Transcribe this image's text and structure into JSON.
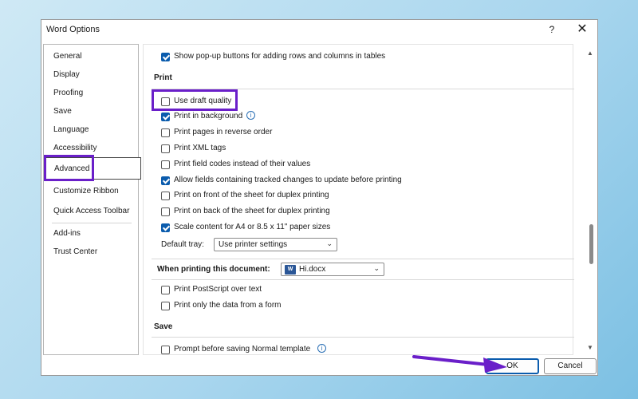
{
  "window": {
    "title": "Word Options",
    "help": "?",
    "close": "✕"
  },
  "nav": {
    "items": [
      {
        "label": "General"
      },
      {
        "label": "Display"
      },
      {
        "label": "Proofing"
      },
      {
        "label": "Save"
      },
      {
        "label": "Language"
      },
      {
        "label": "Accessibility"
      },
      {
        "label": "Advanced"
      },
      {
        "label": "Customize Ribbon"
      },
      {
        "label": "Quick Access Toolbar"
      },
      {
        "label": "Add-ins"
      },
      {
        "label": "Trust Center"
      }
    ],
    "selected": "Advanced"
  },
  "content": {
    "top_option": {
      "label": "Show pop-up buttons for adding rows and columns in tables",
      "checked": true
    },
    "print": {
      "heading": "Print",
      "options": [
        {
          "label": "Use draft quality",
          "checked": false
        },
        {
          "label": "Print in background",
          "checked": true
        },
        {
          "label": "Print pages in reverse order",
          "checked": false
        },
        {
          "label": "Print XML tags",
          "checked": false
        },
        {
          "label": "Print field codes instead of their values",
          "checked": false
        },
        {
          "label": "Allow fields containing tracked changes to update before printing",
          "checked": true
        },
        {
          "label": "Print on front of the sheet for duplex printing",
          "checked": false
        },
        {
          "label": "Print on back of the sheet for duplex printing",
          "checked": false
        },
        {
          "label": "Scale content for A4 or 8.5 x 11\" paper sizes",
          "checked": true
        }
      ],
      "default_tray_label": "Default tray:",
      "default_tray_value": "Use printer settings"
    },
    "when_printing": {
      "label": "When printing this document:",
      "document": "Hi.docx",
      "options": [
        {
          "label": "Print PostScript over text",
          "checked": false
        },
        {
          "label": "Print only the data from a form",
          "checked": false
        }
      ]
    },
    "save": {
      "heading": "Save",
      "options": [
        {
          "label": "Prompt before saving Normal template",
          "checked": false
        }
      ]
    }
  },
  "buttons": {
    "ok": "OK",
    "cancel": "Cancel"
  },
  "colors": {
    "accent": "#0b5cad",
    "annotation": "#6a1fc9"
  },
  "icons": [
    "help-icon",
    "close-icon",
    "info-icon",
    "chevron-down-icon",
    "word-doc-icon",
    "scroll-up-icon",
    "scroll-down-icon",
    "arrow-annotation"
  ]
}
